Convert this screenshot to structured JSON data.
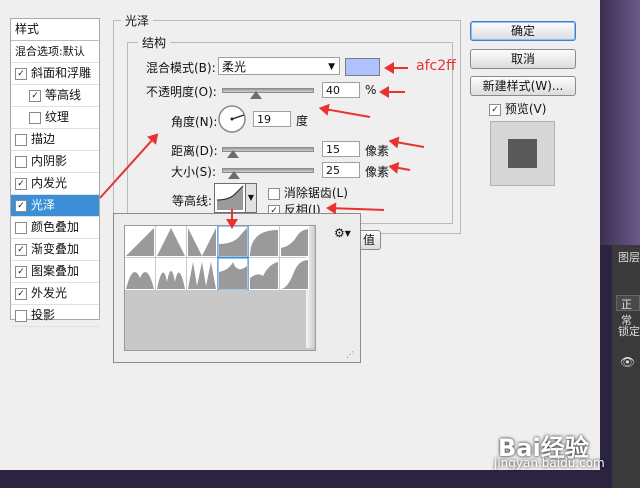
{
  "sidebar": {
    "title": "样式",
    "blend_default": "混合选项:默认",
    "items": [
      {
        "label": "斜面和浮雕",
        "checked": true
      },
      {
        "label": "等高线",
        "checked": true
      },
      {
        "label": "纹理",
        "checked": false
      },
      {
        "label": "描边",
        "checked": false
      },
      {
        "label": "内阴影",
        "checked": false
      },
      {
        "label": "内发光",
        "checked": true
      },
      {
        "label": "光泽",
        "checked": true,
        "active": true
      },
      {
        "label": "颜色叠加",
        "checked": false
      },
      {
        "label": "渐变叠加",
        "checked": true
      },
      {
        "label": "图案叠加",
        "checked": true
      },
      {
        "label": "外发光",
        "checked": true
      },
      {
        "label": "投影",
        "checked": false
      }
    ]
  },
  "satin": {
    "title": "光泽",
    "structure_title": "结构",
    "blend_mode_label": "混合模式(B):",
    "blend_mode_value": "柔光",
    "color_swatch": "#afc2ff",
    "opacity_label": "不透明度(O):",
    "opacity_value": "40",
    "opacity_unit": "%",
    "angle_label": "角度(N):",
    "angle_value": "19",
    "angle_unit": "度",
    "distance_label": "距离(D):",
    "distance_value": "15",
    "distance_unit": "像素",
    "size_label": "大小(S):",
    "size_value": "25",
    "size_unit": "像素",
    "contour_label": "等高线:",
    "antialias_label": "消除锯齿(L)",
    "antialias_checked": false,
    "invert_label": "反相(I)",
    "invert_checked": true,
    "hidden_button_tail": "值"
  },
  "buttons": {
    "ok": "确定",
    "cancel": "取消",
    "new_style": "新建样式(W)...",
    "preview_label": "预览(V)",
    "preview_checked": true
  },
  "annotation": {
    "color_text": "afc2ff"
  },
  "right_panel": {
    "layers_tab": "图层",
    "mode": "正常",
    "lock": "锁定"
  },
  "watermark": {
    "brand": "Bai经验",
    "url": "jingyan.baidu.com"
  }
}
